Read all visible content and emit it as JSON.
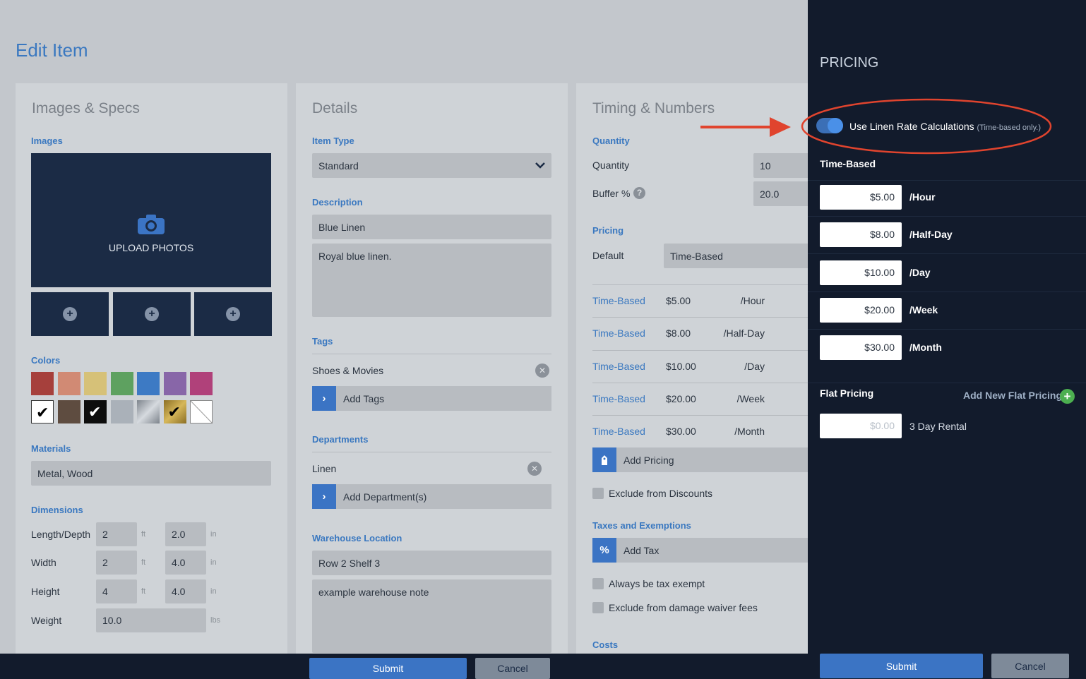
{
  "page": {
    "title": "Edit Item"
  },
  "images_specs": {
    "title": "Images & Specs",
    "images_label": "Images",
    "upload_label": "UPLOAD PHOTOS",
    "colors_label": "Colors",
    "colors": [
      {
        "hex": "#a6403c",
        "checked": false
      },
      {
        "hex": "#d18a74",
        "checked": false
      },
      {
        "hex": "#d6c178",
        "checked": false
      },
      {
        "hex": "#5ea160",
        "checked": false
      },
      {
        "hex": "#3d7ac4",
        "checked": false
      },
      {
        "hex": "#8866a8",
        "checked": false
      },
      {
        "hex": "#b0417a",
        "checked": false
      },
      {
        "hex": "#ffffff",
        "checked": true
      },
      {
        "hex": "#5e4c40",
        "checked": false
      },
      {
        "hex": "#0d0d0d",
        "checked": true
      },
      {
        "hex": "#aab1b9",
        "checked": false
      },
      {
        "hex": "#9aa0a8",
        "checked": false
      },
      {
        "hex": "#b59a45",
        "checked": true
      },
      {
        "hex": "#ffffff",
        "checked": false
      }
    ],
    "materials_label": "Materials",
    "materials_value": "Metal, Wood",
    "dimensions_label": "Dimensions",
    "dims": {
      "length_label": "Length/Depth",
      "length_ft": "2",
      "length_in": "2.0",
      "width_label": "Width",
      "width_ft": "2",
      "width_in": "4.0",
      "height_label": "Height",
      "height_ft": "4",
      "height_in": "4.0",
      "weight_label": "Weight",
      "weight_value": "10.0",
      "unit_ft": "ft",
      "unit_in": "in",
      "unit_lbs": "lbs"
    }
  },
  "details": {
    "title": "Details",
    "item_type_label": "Item Type",
    "item_type_value": "Standard",
    "description_label": "Description",
    "description_name": "Blue Linen",
    "description_text": "Royal blue linen.",
    "tags_label": "Tags",
    "tag_item": "Shoes & Movies",
    "add_tags": "Add Tags",
    "departments_label": "Departments",
    "department_item": "Linen",
    "add_departments": "Add Department(s)",
    "warehouse_label": "Warehouse Location",
    "warehouse_value": "Row 2 Shelf 3",
    "warehouse_note": "example warehouse note"
  },
  "timing": {
    "title": "Timing & Numbers",
    "quantity_label": "Quantity",
    "quantity_field_label": "Quantity",
    "quantity_value": "10",
    "buffer_label": "Buffer %",
    "buffer_value": "20.0",
    "pricing_label": "Pricing",
    "default_label": "Default",
    "default_value": "Time-Based",
    "rows": [
      {
        "type": "Time-Based",
        "amount": "$5.00",
        "unit": "/Hour"
      },
      {
        "type": "Time-Based",
        "amount": "$8.00",
        "unit": "/Half-Day"
      },
      {
        "type": "Time-Based",
        "amount": "$10.00",
        "unit": "/Day"
      },
      {
        "type": "Time-Based",
        "amount": "$20.00",
        "unit": "/Week"
      },
      {
        "type": "Time-Based",
        "amount": "$30.00",
        "unit": "/Month"
      }
    ],
    "add_pricing": "Add Pricing",
    "exclude_discounts": "Exclude from Discounts",
    "taxes_label": "Taxes and Exemptions",
    "add_tax": "Add Tax",
    "always_tax_exempt": "Always be tax exempt",
    "exclude_damage": "Exclude from damage waiver fees",
    "costs_label": "Costs"
  },
  "footer": {
    "submit": "Submit",
    "cancel": "Cancel"
  },
  "drawer": {
    "title": "PRICING",
    "toggle_label": "Use Linen Rate Calculations",
    "toggle_note": "(Time-based only.)",
    "time_based_label": "Time-Based",
    "time_rows": [
      {
        "amount": "$5.00",
        "unit": "/Hour"
      },
      {
        "amount": "$8.00",
        "unit": "/Half-Day"
      },
      {
        "amount": "$10.00",
        "unit": "/Day"
      },
      {
        "amount": "$20.00",
        "unit": "/Week"
      },
      {
        "amount": "$30.00",
        "unit": "/Month"
      }
    ],
    "flat_label": "Flat Pricing",
    "add_flat": "Add New Flat Pricing",
    "flat_placeholder": "$0.00",
    "flat_unit": "3 Day Rental",
    "submit": "Submit",
    "cancel": "Cancel"
  },
  "colors": {
    "accent": "#3a78c0",
    "navy": "#1b2b45",
    "drawer_bg": "#121b2c",
    "annotation_red": "#e0442e"
  }
}
